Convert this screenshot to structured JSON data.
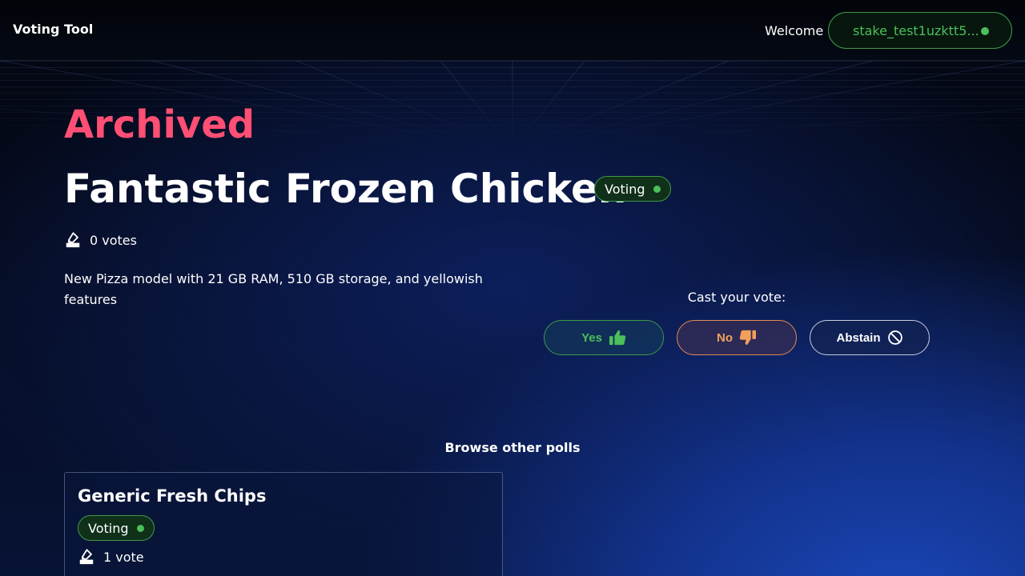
{
  "header": {
    "brand": "Voting Tool",
    "welcome": "Welcome",
    "wallet_address": "stake_test1uzktt5..."
  },
  "poll": {
    "status": "Archived",
    "title": "Fantastic Frozen Chicken",
    "badge": "Voting",
    "votes": "0 votes",
    "description": "New Pizza model with 21 GB RAM, 510 GB storage, and yellowish features"
  },
  "vote": {
    "prompt": "Cast your vote:",
    "yes_label": "Yes",
    "no_label": "No",
    "abstain_label": "Abstain"
  },
  "browse": {
    "title": "Browse other polls",
    "polls": [
      {
        "title": "Generic Fresh Chips",
        "badge": "Voting",
        "votes": "1 vote"
      }
    ]
  },
  "icons": {
    "ballot": "ballot-icon",
    "yes": "thumbs-up-icon",
    "no": "thumbs-down-icon",
    "abstain": "prohibited-icon",
    "status_dot": "status-dot-icon"
  },
  "colors": {
    "archived": "#ff4f74",
    "accent_green": "#4cbf5a",
    "accent_orange": "#f2a05a",
    "background": "#050b1e"
  }
}
